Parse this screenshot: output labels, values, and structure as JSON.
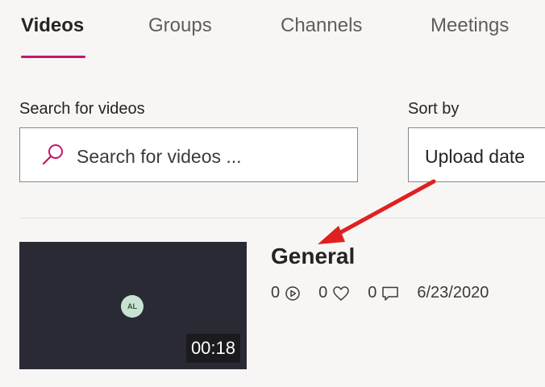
{
  "tabs": [
    {
      "label": "Videos",
      "active": true
    },
    {
      "label": "Groups",
      "active": false
    },
    {
      "label": "Channels",
      "active": false
    },
    {
      "label": "Meetings",
      "active": false
    }
  ],
  "search": {
    "label": "Search for videos",
    "placeholder": "Search for videos ..."
  },
  "sort": {
    "label": "Sort by",
    "value": "Upload date"
  },
  "video": {
    "title": "General",
    "duration": "00:18",
    "avatar_initials": "AL",
    "views": "0",
    "likes": "0",
    "comments": "0",
    "date": "6/23/2020"
  },
  "colors": {
    "accent": "#c4156a",
    "arrow": "#e02020",
    "thumbnail_bg": "#292a33"
  },
  "icons": {
    "views": "play-circle-icon",
    "likes": "heart-icon",
    "comments": "comment-icon",
    "search": "search-icon"
  }
}
